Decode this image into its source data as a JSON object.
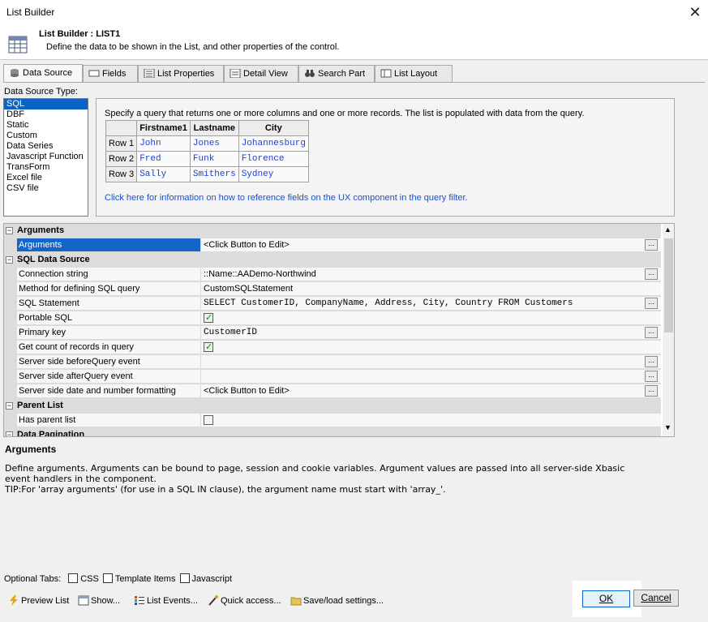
{
  "window": {
    "title": "List Builder",
    "close_glyph": "✕"
  },
  "header": {
    "title": "List Builder : LIST1",
    "description": "Define the data to be shown in the List, and other properties of the control.",
    "icon": "list-grid-icon"
  },
  "tabs": [
    {
      "label": "Data Source",
      "icon": "database-icon",
      "active": true
    },
    {
      "label": "Fields",
      "icon": "field-icon"
    },
    {
      "label": "List Properties",
      "icon": "properties-icon"
    },
    {
      "label": "Detail View",
      "icon": "detail-view-icon"
    },
    {
      "label": "Search Part",
      "icon": "binoculars-icon"
    },
    {
      "label": "List Layout",
      "icon": "layout-icon"
    }
  ],
  "data_source_type": {
    "label": "Data Source Type:",
    "items": [
      "SQL",
      "DBF",
      "Static",
      "Custom",
      "Data Series",
      "Javascript Function",
      "TransForm",
      "Excel file",
      "CSV file"
    ],
    "selected": "SQL"
  },
  "info": {
    "description": "Specify a query that returns one or more columns and one or more records. The list is populated with data from the query.",
    "table": {
      "headers": [
        "",
        "Firstname1",
        "Lastname",
        "City"
      ],
      "rows": [
        {
          "label": "Row 1",
          "values": [
            "John",
            "Jones",
            "Johannesburg"
          ]
        },
        {
          "label": "Row 2",
          "values": [
            "Fred",
            "Funk",
            "Florence"
          ]
        },
        {
          "label": "Row 3",
          "values": [
            "Sally",
            "Smithers",
            "Sydney"
          ]
        }
      ]
    },
    "link": "Click here for information on how to reference fields on the UX component in the query filter."
  },
  "property_grid": {
    "categories": {
      "arguments": "Arguments",
      "sql_data_source": "SQL Data Source",
      "parent_list": "Parent List",
      "data_pagination": "Data Pagination"
    },
    "props": {
      "arguments": {
        "name": "Arguments",
        "value": "<Click Button to Edit>"
      },
      "connection_string": {
        "name": "Connection string",
        "value": "::Name::AADemo-Northwind"
      },
      "method": {
        "name": "Method for defining SQL query",
        "value": "CustomSQLStatement"
      },
      "sql_statement": {
        "name": "SQL Statement",
        "value": "SELECT CustomerID, CompanyName, Address, City, Country FROM Customers"
      },
      "portable_sql": {
        "name": "Portable SQL",
        "checked": true
      },
      "primary_key": {
        "name": "Primary key",
        "value": "CustomerID"
      },
      "get_count": {
        "name": "Get count of records in query",
        "checked": true
      },
      "before_query": {
        "name": "Server side beforeQuery event",
        "value": ""
      },
      "after_query": {
        "name": "Server side afterQuery event",
        "value": ""
      },
      "date_format": {
        "name": "Server side date and number formatting",
        "value": "<Click Button to Edit>"
      },
      "has_parent": {
        "name": "Has parent list",
        "checked": false
      }
    },
    "ellipsis": "..."
  },
  "help": {
    "title": "Arguments",
    "line1": "Define arguments. Arguments can be bound to page, session and cookie variables. Argument values are passed into all server-side Xbasic",
    "line2": "event handlers in the component.",
    "line3": "TIP:For 'array arguments' (for use in a SQL IN clause), the argument name must start with 'array_'."
  },
  "optional_tabs": {
    "label": "Optional Tabs:",
    "items": [
      {
        "label": "CSS",
        "checked": false
      },
      {
        "label": "Template Items",
        "checked": false
      },
      {
        "label": "Javascript",
        "checked": false
      }
    ]
  },
  "actions": [
    {
      "label": "Preview List",
      "icon": "lightning-icon"
    },
    {
      "label": "Show...",
      "icon": "window-icon"
    },
    {
      "label": "List Events...",
      "icon": "events-icon"
    },
    {
      "label": "Quick access...",
      "icon": "wand-icon"
    },
    {
      "label": "Save/load settings...",
      "icon": "folder-icon"
    }
  ],
  "buttons": {
    "ok": "OK",
    "cancel": "Cancel"
  },
  "colors": {
    "selection": "#0a64c8",
    "link": "#1a4fd0",
    "sample_value": "#1f3fd6"
  }
}
